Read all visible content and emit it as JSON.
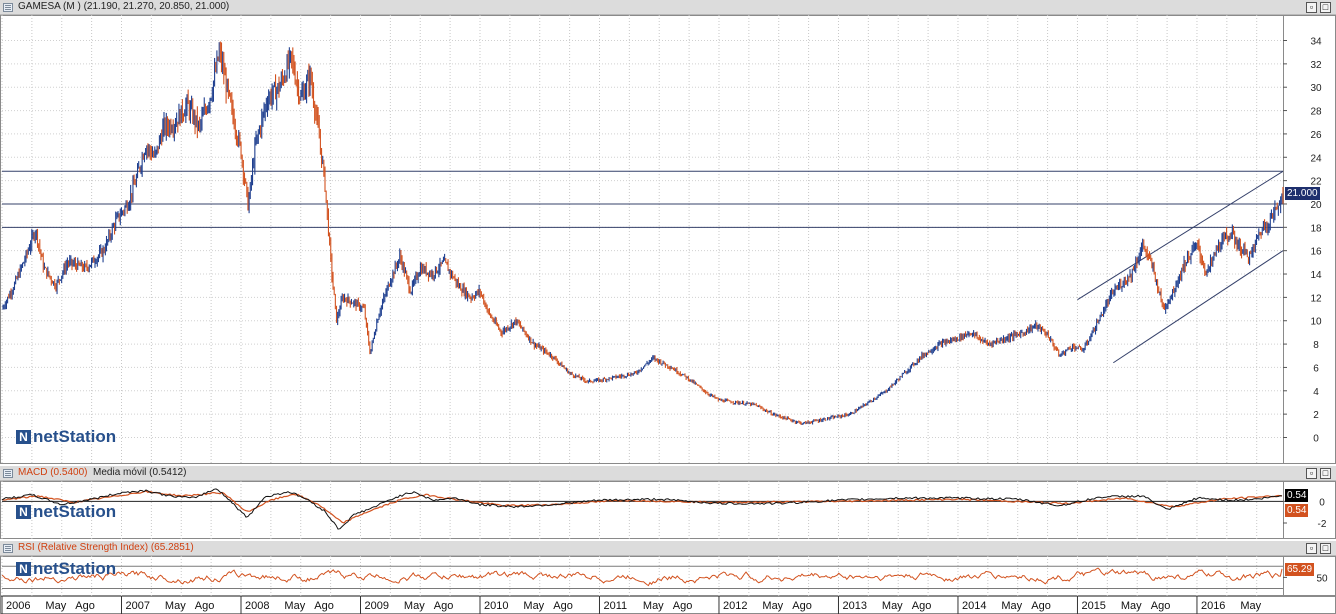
{
  "price_panel": {
    "title": "GAMESA (M )",
    "ohlc": "(21.190, 21.270, 20.850, 21.000)",
    "last_label": "21.000",
    "logo": "netStation"
  },
  "macd_panel": {
    "title": "MACD (0.5400)",
    "ma_label": "Media móvil (0.5412)",
    "macd_badge": "0.54",
    "signal_badge": "0.54",
    "logo": "netStation"
  },
  "rsi_panel": {
    "title": "RSI (Relative Strength Index) (65.2851)",
    "rsi_badge": "65.29",
    "logo": "netStation"
  },
  "window_buttons": {
    "restore": "▫",
    "max": "□"
  },
  "colors": {
    "up": "#1f3f8f",
    "down": "#d2521f",
    "frame": "#8a8a8a",
    "hline": "#34406a",
    "badge_price": "#1e2f6d",
    "badge_rsi": "#d2521f"
  },
  "x_axis": {
    "labels": [
      "2006",
      "May",
      "Ago",
      "2007",
      "May",
      "Ago",
      "2008",
      "May",
      "Ago",
      "2009",
      "May",
      "Ago",
      "2010",
      "May",
      "Ago",
      "2011",
      "May",
      "Ago",
      "2012",
      "May",
      "Ago",
      "2013",
      "May",
      "Ago",
      "2014",
      "May",
      "Ago",
      "2015",
      "May",
      "Ago",
      "2016",
      "May"
    ],
    "year_starts": [
      2006,
      2007,
      2008,
      2009,
      2010,
      2011,
      2012,
      2013,
      2014,
      2015,
      2016
    ]
  },
  "chart_data": [
    {
      "type": "line",
      "series_kind": "price (OHLC bars, weekly)",
      "y_ticks": [
        0,
        2,
        4,
        6,
        8,
        10,
        12,
        14,
        16,
        18,
        20,
        22,
        24,
        26,
        28,
        30,
        32,
        34
      ],
      "ylim": [
        -1.5,
        35.5
      ],
      "x_range": [
        2006.0,
        2016.72
      ],
      "horizontal_lines": [
        22.8,
        20.0,
        18.0
      ],
      "channel_lines": [
        {
          "from": [
            2015.0,
            11.8
          ],
          "to": [
            2016.72,
            22.8
          ]
        },
        {
          "from": [
            2015.3,
            6.4
          ],
          "to": [
            2016.72,
            16.0
          ]
        }
      ],
      "points": [
        [
          2006.0,
          11.0
        ],
        [
          2006.1,
          13.0
        ],
        [
          2006.2,
          15.5
        ],
        [
          2006.28,
          17.8
        ],
        [
          2006.35,
          14.5
        ],
        [
          2006.45,
          13.0
        ],
        [
          2006.55,
          15.0
        ],
        [
          2006.7,
          14.5
        ],
        [
          2006.85,
          16.0
        ],
        [
          2006.95,
          18.5
        ],
        [
          2007.05,
          20.0
        ],
        [
          2007.12,
          22.0
        ],
        [
          2007.2,
          25.0
        ],
        [
          2007.28,
          24.0
        ],
        [
          2007.35,
          26.5
        ],
        [
          2007.45,
          27.0
        ],
        [
          2007.55,
          28.5
        ],
        [
          2007.65,
          26.5
        ],
        [
          2007.75,
          29.5
        ],
        [
          2007.82,
          33.0
        ],
        [
          2007.9,
          29.0
        ],
        [
          2008.0,
          24.5
        ],
        [
          2008.06,
          19.8
        ],
        [
          2008.12,
          25.0
        ],
        [
          2008.22,
          29.0
        ],
        [
          2008.32,
          30.0
        ],
        [
          2008.42,
          32.5
        ],
        [
          2008.5,
          29.0
        ],
        [
          2008.58,
          31.0
        ],
        [
          2008.65,
          26.0
        ],
        [
          2008.7,
          22.0
        ],
        [
          2008.76,
          14.0
        ],
        [
          2008.8,
          10.0
        ],
        [
          2008.85,
          12.0
        ],
        [
          2008.95,
          11.5
        ],
        [
          2009.03,
          11.0
        ],
        [
          2009.08,
          7.2
        ],
        [
          2009.15,
          10.5
        ],
        [
          2009.25,
          13.5
        ],
        [
          2009.33,
          15.5
        ],
        [
          2009.42,
          12.5
        ],
        [
          2009.5,
          14.5
        ],
        [
          2009.6,
          14.0
        ],
        [
          2009.7,
          15.0
        ],
        [
          2009.82,
          13.0
        ],
        [
          2009.92,
          12.0
        ],
        [
          2010.0,
          12.5
        ],
        [
          2010.08,
          10.5
        ],
        [
          2010.18,
          9.0
        ],
        [
          2010.3,
          10.0
        ],
        [
          2010.45,
          8.0
        ],
        [
          2010.6,
          7.0
        ],
        [
          2010.75,
          5.5
        ],
        [
          2010.9,
          4.8
        ],
        [
          2011.0,
          4.9
        ],
        [
          2011.15,
          5.2
        ],
        [
          2011.3,
          5.5
        ],
        [
          2011.45,
          6.8
        ],
        [
          2011.6,
          6.0
        ],
        [
          2011.75,
          5.0
        ],
        [
          2011.9,
          3.8
        ],
        [
          2012.0,
          3.2
        ],
        [
          2012.15,
          3.0
        ],
        [
          2012.3,
          2.8
        ],
        [
          2012.45,
          2.0
        ],
        [
          2012.6,
          1.5
        ],
        [
          2012.7,
          1.2
        ],
        [
          2012.8,
          1.4
        ],
        [
          2012.95,
          1.7
        ],
        [
          2013.1,
          2.0
        ],
        [
          2013.25,
          3.0
        ],
        [
          2013.4,
          4.0
        ],
        [
          2013.55,
          5.5
        ],
        [
          2013.7,
          7.0
        ],
        [
          2013.85,
          8.0
        ],
        [
          2014.0,
          8.5
        ],
        [
          2014.1,
          9.0
        ],
        [
          2014.25,
          8.0
        ],
        [
          2014.4,
          8.5
        ],
        [
          2014.55,
          9.0
        ],
        [
          2014.65,
          9.6
        ],
        [
          2014.75,
          8.8
        ],
        [
          2014.85,
          7.0
        ],
        [
          2014.95,
          7.8
        ],
        [
          2015.05,
          7.5
        ],
        [
          2015.15,
          9.5
        ],
        [
          2015.3,
          12.5
        ],
        [
          2015.45,
          14.0
        ],
        [
          2015.55,
          16.5
        ],
        [
          2015.63,
          14.5
        ],
        [
          2015.72,
          11.0
        ],
        [
          2015.8,
          12.5
        ],
        [
          2015.9,
          15.0
        ],
        [
          2016.0,
          16.5
        ],
        [
          2016.08,
          14.0
        ],
        [
          2016.18,
          16.5
        ],
        [
          2016.28,
          17.5
        ],
        [
          2016.38,
          16.0
        ],
        [
          2016.45,
          15.5
        ],
        [
          2016.52,
          17.5
        ],
        [
          2016.6,
          18.5
        ],
        [
          2016.66,
          19.5
        ],
        [
          2016.72,
          21.0
        ]
      ]
    },
    {
      "type": "line",
      "series_kind": "MACD and moving average",
      "y_ticks": [
        0,
        -2
      ],
      "ylim": [
        -3.2,
        1.6
      ],
      "series": [
        {
          "name": "MACD",
          "points": [
            [
              2006.0,
              0.2
            ],
            [
              2006.25,
              0.6
            ],
            [
              2006.5,
              -0.3
            ],
            [
              2006.75,
              0.2
            ],
            [
              2007.0,
              0.8
            ],
            [
              2007.2,
              1.0
            ],
            [
              2007.4,
              0.5
            ],
            [
              2007.6,
              0.3
            ],
            [
              2007.8,
              1.2
            ],
            [
              2007.95,
              -0.4
            ],
            [
              2008.05,
              -1.5
            ],
            [
              2008.2,
              0.4
            ],
            [
              2008.4,
              0.9
            ],
            [
              2008.55,
              0.2
            ],
            [
              2008.7,
              -0.9
            ],
            [
              2008.82,
              -2.6
            ],
            [
              2008.95,
              -1.2
            ],
            [
              2009.1,
              -0.6
            ],
            [
              2009.3,
              0.4
            ],
            [
              2009.45,
              0.9
            ],
            [
              2009.6,
              0.1
            ],
            [
              2009.8,
              0.3
            ],
            [
              2010.0,
              -0.3
            ],
            [
              2010.3,
              -0.5
            ],
            [
              2010.6,
              -0.3
            ],
            [
              2011.0,
              0.1
            ],
            [
              2011.5,
              0.2
            ],
            [
              2012.0,
              -0.2
            ],
            [
              2012.5,
              -0.2
            ],
            [
              2013.0,
              0.1
            ],
            [
              2013.5,
              0.3
            ],
            [
              2014.0,
              0.3
            ],
            [
              2014.5,
              0.2
            ],
            [
              2014.85,
              -0.4
            ],
            [
              2015.2,
              0.4
            ],
            [
              2015.55,
              0.5
            ],
            [
              2015.75,
              -0.8
            ],
            [
              2016.0,
              0.3
            ],
            [
              2016.3,
              0.1
            ],
            [
              2016.5,
              0.2
            ],
            [
              2016.72,
              0.54
            ]
          ]
        },
        {
          "name": "Media móvil",
          "points": [
            [
              2006.0,
              0.1
            ],
            [
              2006.3,
              0.5
            ],
            [
              2006.6,
              -0.1
            ],
            [
              2006.9,
              0.4
            ],
            [
              2007.2,
              0.9
            ],
            [
              2007.5,
              0.5
            ],
            [
              2007.85,
              0.8
            ],
            [
              2008.05,
              -1.0
            ],
            [
              2008.25,
              0.1
            ],
            [
              2008.45,
              0.7
            ],
            [
              2008.65,
              -0.3
            ],
            [
              2008.85,
              -2.0
            ],
            [
              2009.05,
              -1.0
            ],
            [
              2009.35,
              0.2
            ],
            [
              2009.55,
              0.6
            ],
            [
              2009.85,
              0.1
            ],
            [
              2010.2,
              -0.4
            ],
            [
              2010.6,
              -0.3
            ],
            [
              2011.2,
              0.1
            ],
            [
              2012.0,
              -0.1
            ],
            [
              2013.0,
              0.0
            ],
            [
              2014.0,
              0.2
            ],
            [
              2014.9,
              -0.2
            ],
            [
              2015.4,
              0.3
            ],
            [
              2015.8,
              -0.5
            ],
            [
              2016.2,
              0.2
            ],
            [
              2016.72,
              0.54
            ]
          ]
        }
      ]
    },
    {
      "type": "line",
      "series_kind": "RSI",
      "y_ticks": [
        50
      ],
      "ylim": [
        20,
        85
      ],
      "reference_lines": [
        70,
        30
      ],
      "last_value": 65.29
    }
  ]
}
